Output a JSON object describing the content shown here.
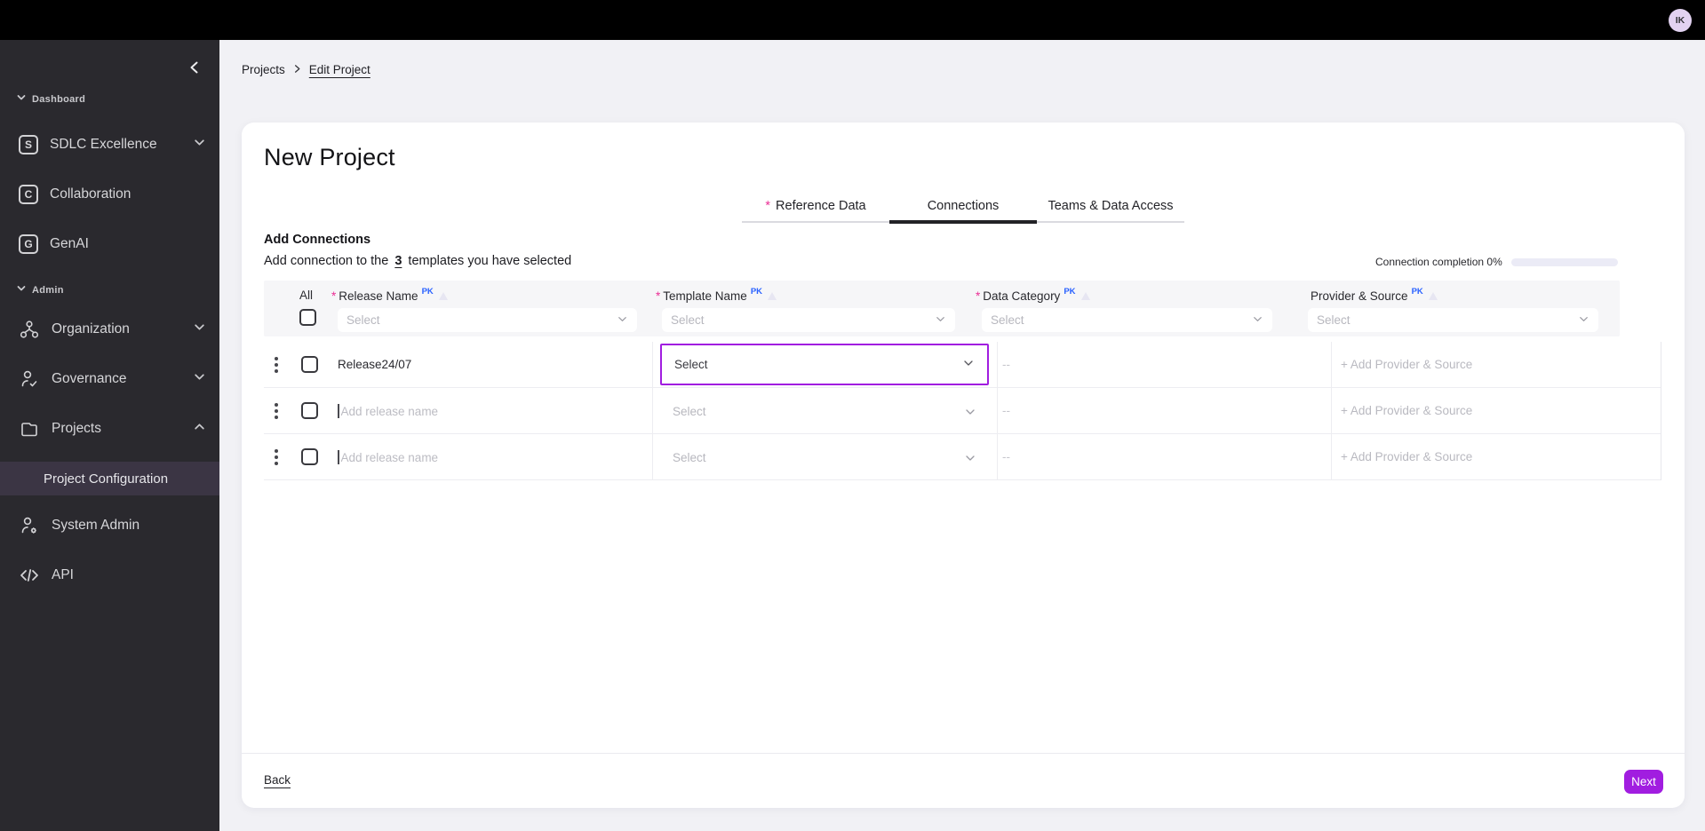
{
  "topbar": {
    "avatar_initials": "IK"
  },
  "sidebar": {
    "groups": [
      {
        "label": "Dashboard",
        "items": [
          {
            "label": "SDLC Excellence",
            "icon": "s-letter-icon",
            "chevron": "down"
          },
          {
            "label": "Collaboration",
            "icon": "c-letter-icon"
          },
          {
            "label": "GenAI",
            "icon": "g-letter-icon"
          }
        ]
      },
      {
        "label": "Admin",
        "items": [
          {
            "label": "Organization",
            "icon": "org-chart-icon",
            "chevron": "down"
          },
          {
            "label": "Governance",
            "icon": "user-check-icon",
            "chevron": "down"
          },
          {
            "label": "Projects",
            "icon": "folder-icon",
            "chevron": "up"
          },
          {
            "label": "System Admin",
            "icon": "user-gear-icon"
          },
          {
            "label": "API",
            "icon": "code-icon"
          }
        ]
      }
    ],
    "sub_item": {
      "label": "Project Configuration",
      "selected": true
    }
  },
  "breadcrumb": {
    "root": "Projects",
    "current": "Edit Project"
  },
  "page": {
    "title": "New Project",
    "required_marker": "*",
    "tabs": [
      {
        "label": "Reference Data",
        "required": true,
        "active": false
      },
      {
        "label": "Connections",
        "required": false,
        "active": true
      },
      {
        "label": "Teams & Data Access",
        "required": false,
        "active": false
      }
    ]
  },
  "connections": {
    "section_title": "Add Connections",
    "subtitle": {
      "prefix": "Add connection to the",
      "count": "3",
      "suffix": "templates you have selected"
    },
    "completion_text": "Connection completion 0%",
    "completion_percent": 0,
    "table": {
      "select_all_label": "All",
      "columns": [
        {
          "label": "Release Name",
          "required": true,
          "badge": "PK",
          "placeholder": "Select"
        },
        {
          "label": "Template Name",
          "required": true,
          "badge": "PK",
          "placeholder": "Select"
        },
        {
          "label": "Data Category",
          "required": true,
          "badge": "PK",
          "placeholder": "Select"
        },
        {
          "label": "Provider & Source",
          "required": false,
          "badge": "PK",
          "placeholder": "Select"
        }
      ],
      "rows": [
        {
          "release_name": "Release24/07",
          "release_placeholder": "",
          "template_value": "Select",
          "template_focused": true,
          "data_category": "--",
          "provider_action": "+ Add Provider & Source"
        },
        {
          "release_name": "",
          "release_placeholder": "Add release name",
          "template_value": "Select",
          "template_focused": false,
          "data_category": "--",
          "provider_action": "+ Add Provider & Source"
        },
        {
          "release_name": "",
          "release_placeholder": "Add release name",
          "template_value": "Select",
          "template_focused": false,
          "data_category": "--",
          "provider_action": "+ Add Provider & Source"
        }
      ]
    }
  },
  "footer": {
    "back_label": "Back",
    "next_label": "Next"
  },
  "colors": {
    "accent": "#A11DE0",
    "required": "#EB2F96",
    "pk_badge": "#2961FF",
    "topbar": "#000000",
    "sidebar_bg": "#2A292E",
    "sidebar_selected": "#3B3544",
    "header_bg": "#F6F6F8",
    "main_bg": "#F1F1F5"
  }
}
